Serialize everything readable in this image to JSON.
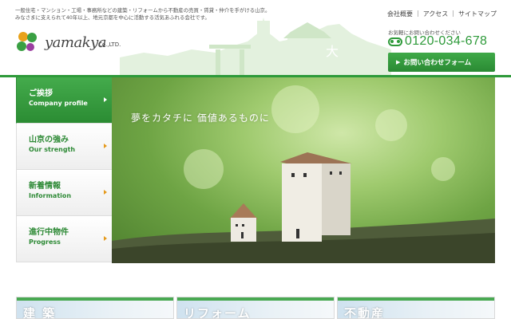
{
  "header": {
    "intro_line1": "一般住宅・マンション・工場・事務所などの建築・リフォームから不動産の売買・賃貸・仲介を手がける山京。",
    "intro_line2": "みなさまに支えられて40年以上、地元京都を中心に活動する活気あふれる会社です。",
    "logo_word": "yamakya",
    "logo_suffix": "Co.,LTD.",
    "topnav": [
      "会社概要",
      "アクセス",
      "サイトマップ"
    ],
    "contact_caption": "お気軽にお問い合わせください",
    "phone": "0120-034-678",
    "cta_label": "お問い合わせフォーム"
  },
  "sidenav": [
    {
      "jp": "ご挨拶",
      "en": "Company profile",
      "active": true
    },
    {
      "jp": "山京の強み",
      "en": "Our strength",
      "active": false
    },
    {
      "jp": "新着情報",
      "en": "Information",
      "active": false
    },
    {
      "jp": "進行中物件",
      "en": "Progress",
      "active": false
    }
  ],
  "hero": {
    "tagline": "夢をカタチに 価値あるものに"
  },
  "cards": [
    {
      "label": "建 築"
    },
    {
      "label": "リフォーム"
    },
    {
      "label": "不動産"
    }
  ],
  "colors": {
    "brand_green": "#2e9a3a",
    "accent_orange": "#e59a1c"
  }
}
